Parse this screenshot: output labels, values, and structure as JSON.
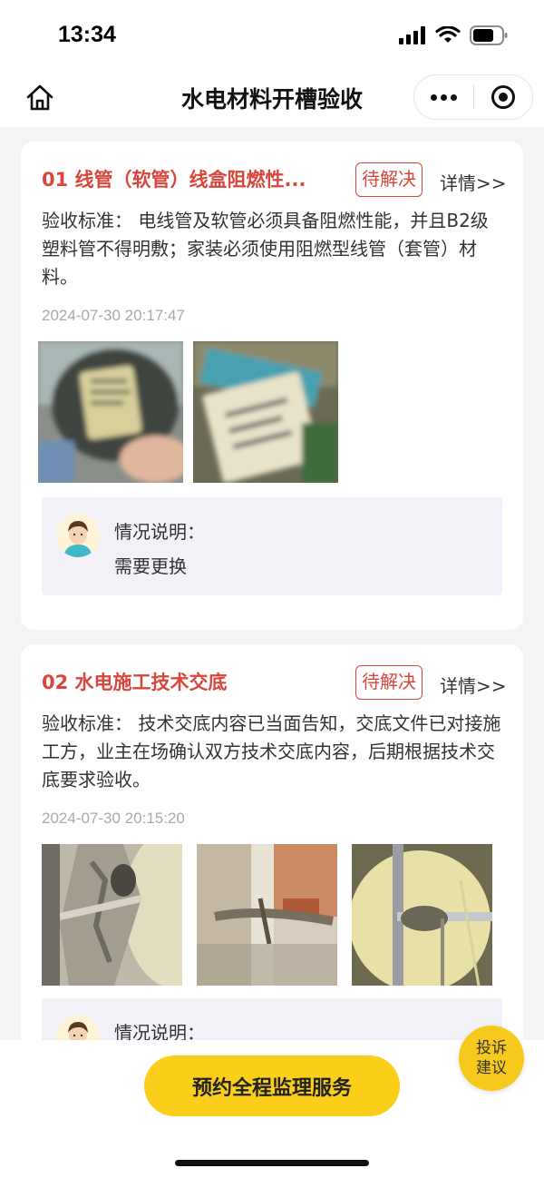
{
  "status_bar": {
    "time": "13:34"
  },
  "nav": {
    "title": "水电材料开槽验收"
  },
  "items": [
    {
      "title": "01 线管（软管）线盒阻燃性...",
      "status": "待解决",
      "detail_link": "详情>>",
      "standard": "验收标准： 电线管及软管必须具备阻燃性能，并且B2级塑料管不得明敷；家装必须使用阻燃型线管（套管）材料。",
      "timestamp": "2024-07-30 20:17:47",
      "note_label": "情况说明：",
      "note_text": "需要更换"
    },
    {
      "title": "02 水电施工技术交底",
      "status": "待解决",
      "detail_link": "详情>>",
      "standard": "验收标准： 技术交底内容已当面告知，交底文件已对接施工方，业主在场确认双方技术交底内容，后期根据技术交底要求验收。",
      "timestamp": "2024-07-30 20:15:20",
      "note_label": "情况说明：",
      "note_text": ""
    }
  ],
  "bottom": {
    "cta_label": "预约全程监理服务"
  },
  "fab": {
    "line1": "投诉",
    "line2": "建议"
  },
  "colors": {
    "accent_red": "#d9463b",
    "brand_yellow": "#fbce1a",
    "page_bg": "#f4f4f6"
  }
}
